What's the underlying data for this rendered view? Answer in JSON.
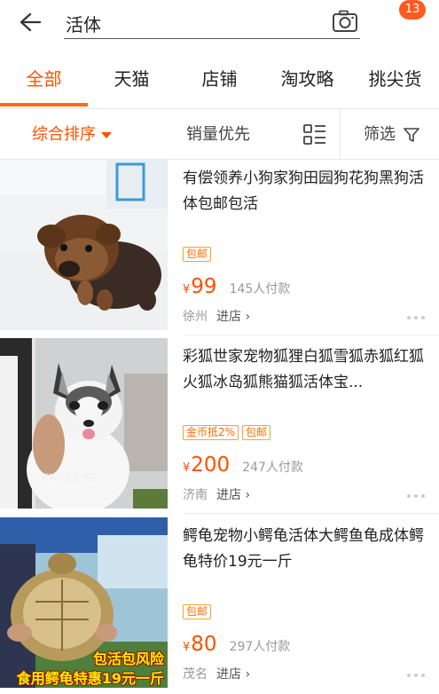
{
  "search": {
    "query": "活体",
    "badge_count": "13"
  },
  "tabs": [
    {
      "label": "全部",
      "active": true
    },
    {
      "label": "天猫",
      "active": false
    },
    {
      "label": "店铺",
      "active": false
    },
    {
      "label": "淘攻略",
      "active": false
    },
    {
      "label": "挑尖货",
      "active": false
    }
  ],
  "sort": {
    "comprehensive": "综合排序",
    "sales": "销量优先",
    "filter": "筛选"
  },
  "products": [
    {
      "title": "有偿领养小狗家狗田园狗花狗黑狗活体包邮包活",
      "tags": [
        "包邮"
      ],
      "currency": "¥",
      "price": "99",
      "sold": "145人付款",
      "location": "徐州",
      "shop": "进店"
    },
    {
      "title": "彩狐世家宠物狐狸白狐雪狐赤狐红狐火狐冰岛狐熊猫狐活体宝...",
      "tags": [
        "金币抵2%",
        "包邮"
      ],
      "currency": "¥",
      "price": "200",
      "sold": "247人付款",
      "location": "济南",
      "shop": "进店",
      "image_watermark": "彩狐世家宠物店"
    },
    {
      "title": "鳄龟宠物小鳄龟活体大鳄鱼龟成体鳄龟特价19元一斤",
      "tags": [
        "包邮"
      ],
      "currency": "¥",
      "price": "80",
      "sold": "297人付款",
      "location": "茂名",
      "shop": "进店",
      "image_overlay": [
        "包活包风险",
        "食用鳄龟特惠19元一斤"
      ]
    }
  ],
  "colors": {
    "accent": "#ff5000",
    "tag_border": "#f5a623",
    "badge": "#ff5a1f"
  }
}
